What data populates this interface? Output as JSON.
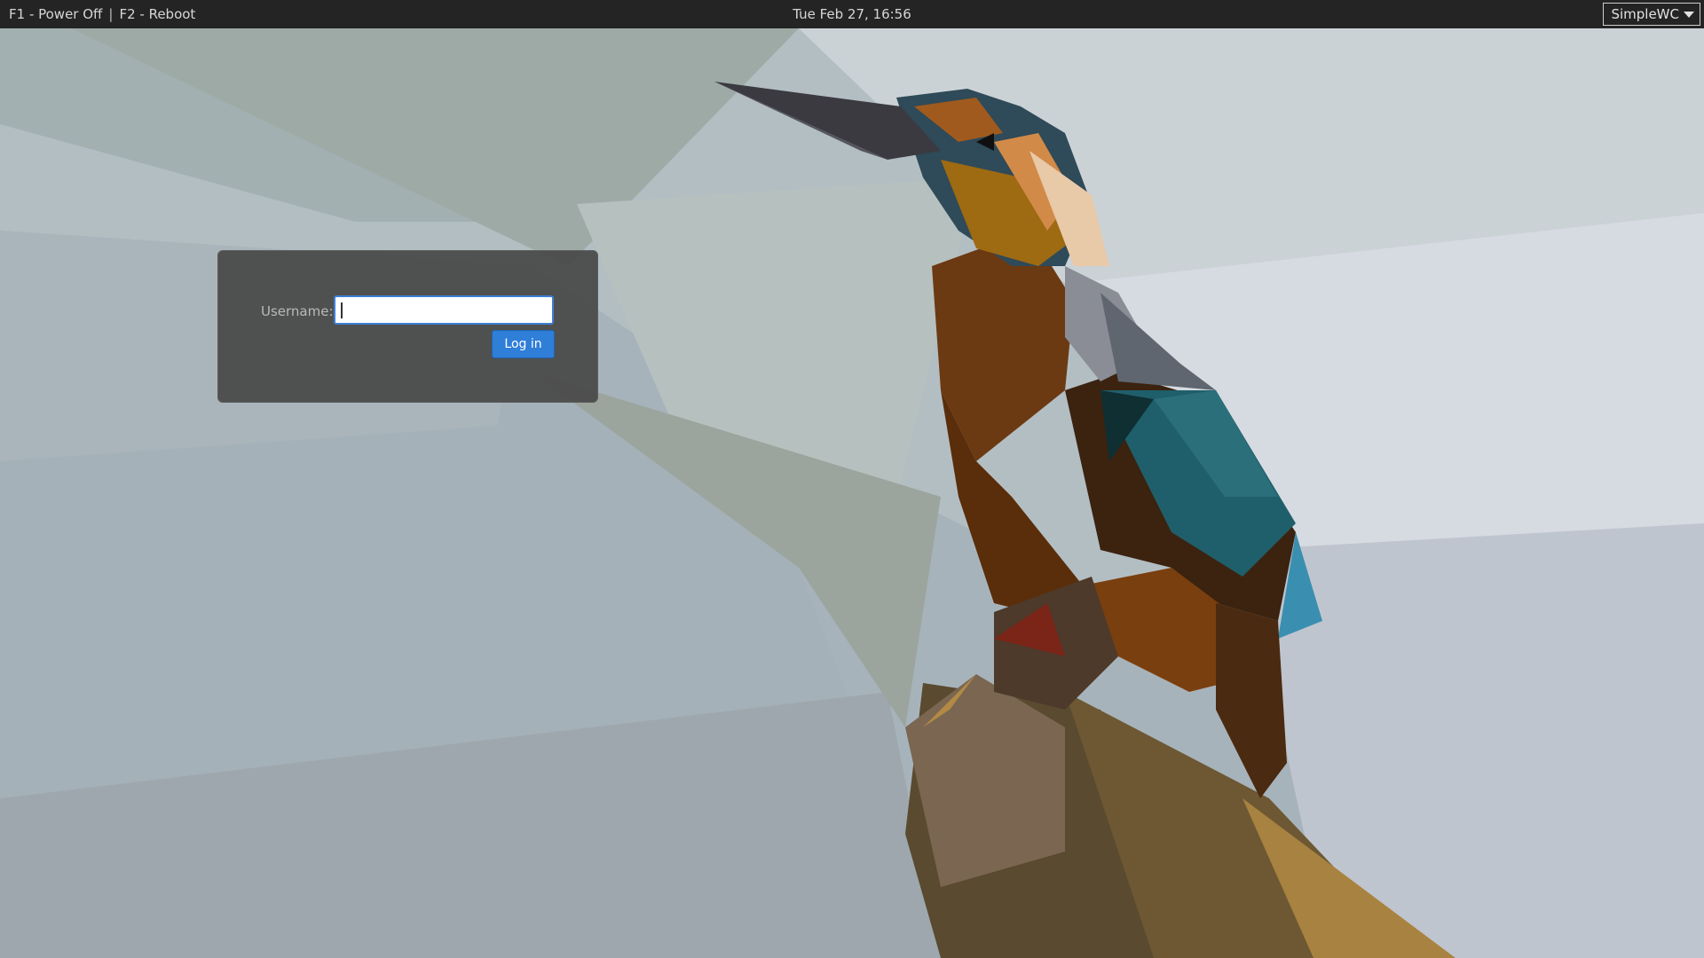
{
  "topbar": {
    "power_off": "F1 - Power Off",
    "separator": "|",
    "reboot": "F2 - Reboot",
    "clock": "Tue Feb 27, 16:56",
    "session": "SimpleWC",
    "session_icon": "chevron-down-icon"
  },
  "login": {
    "username_label": "Username:",
    "username_value": "",
    "login_button": "Log in"
  },
  "colors": {
    "topbar_bg": "#242424",
    "panel_bg": "#484848",
    "button_blue": "#2f7ed8",
    "input_focus": "#3d7fd6"
  }
}
